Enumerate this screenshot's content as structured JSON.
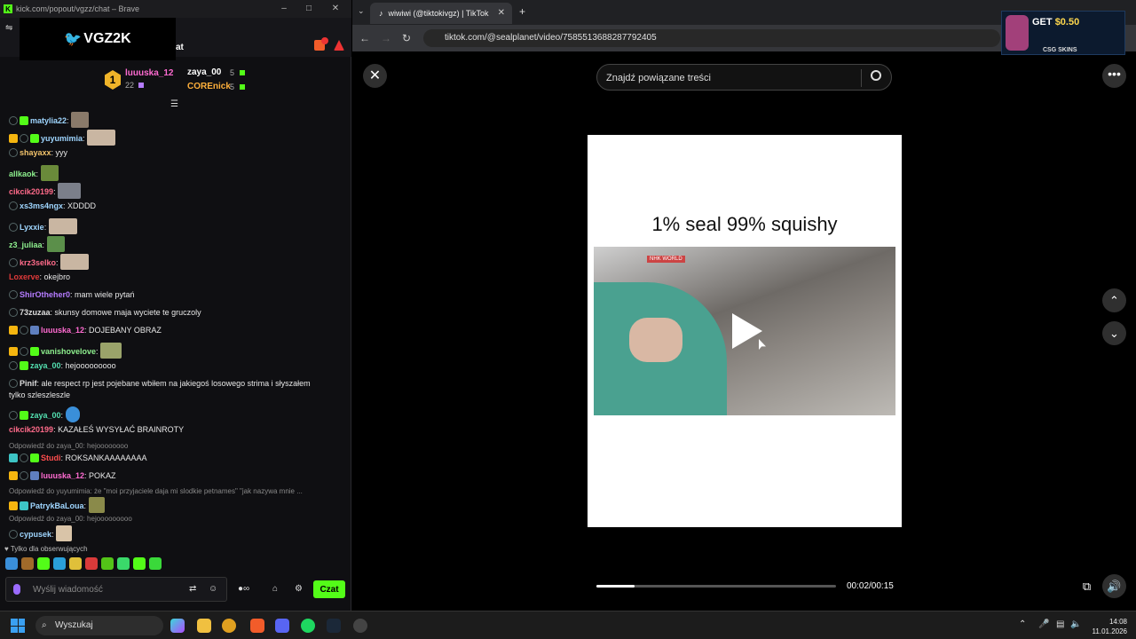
{
  "left_window": {
    "title": "kick.com/popout/vgzz/chat – Brave",
    "banner": "VGZ2K",
    "chat_title": "at"
  },
  "leaderboard": {
    "rank": "1",
    "first": {
      "name": "luuuska_12",
      "count": "22"
    },
    "second": {
      "name": "zaya_00",
      "count": "5"
    },
    "third": {
      "name": "COREnick",
      "count": "5"
    }
  },
  "chat": [
    {
      "user": "matylia22",
      "text": "",
      "color": "#9fd6ff"
    },
    {
      "user": "yuyumimia",
      "text": "",
      "color": "#9fd6ff"
    },
    {
      "user": "shayaxx",
      "text": " yyy",
      "color": "#f2c36b"
    },
    {
      "user": "allkaok",
      "text": "",
      "color": "#8ef08e"
    },
    {
      "user": "cikcik20199",
      "text": "",
      "color": "#ff6b8a"
    },
    {
      "user": "xs3ms4ngx",
      "text": " XDDDD",
      "color": "#9fd6ff"
    },
    {
      "user": "Lyxxie",
      "text": "",
      "color": "#9fd6ff"
    },
    {
      "user": "z3_juliaa",
      "text": "",
      "color": "#8ef08e"
    },
    {
      "user": "krz3selko",
      "text": "",
      "color": "#ff6b8a"
    },
    {
      "user": "Loxerve",
      "text": " okejbro",
      "color": "#e03a3a"
    },
    {
      "user": "ShirOtheher0",
      "text": " mam wiele pytań",
      "color": "#b57cff"
    },
    {
      "user": "73zuzaa",
      "text": " skunsy domowe maja wyciete te gruczoly",
      "color": "#dddddd"
    },
    {
      "user": "luuuska_12",
      "text": " DOJEBANY OBRAZ",
      "color": "#ff6bd1"
    },
    {
      "user": "vanishovelove",
      "text": "",
      "color": "#8ef08e"
    },
    {
      "user": "zaya_00",
      "text": " hejooooooooo",
      "color": "#53e0b0"
    },
    {
      "user": "Pinif",
      "text": " ale respect rp jest pojebane wbiłem na jakiegoś losowego strima i słyszałem",
      "color": "#dddddd"
    },
    {
      "user": "",
      "text": "tylko szleszleszle",
      "color": "#dddddd"
    },
    {
      "user": "zaya_00",
      "text": "",
      "color": "#53e0b0"
    },
    {
      "user": "cikcik20199",
      "text": " KAZAŁEŚ WYSYŁAĆ BRAINROTY",
      "color": "#ff6b8a"
    },
    {
      "user": "Studi",
      "text": " ROKSANKAAAAAAAA",
      "color": "#ff4d4d"
    },
    {
      "user": "luuuska_12",
      "text": " POKAZ",
      "color": "#ff6bd1"
    },
    {
      "user": "PatrykBaLoua",
      "text": "",
      "color": "#9fd6ff"
    },
    {
      "user": "cypusek",
      "text": "",
      "color": "#9fd6ff"
    }
  ],
  "replies": [
    "Odpowiedź do zaya_00: hejoooooooo",
    "Odpowiedź do yuyumimia: że \"moi przyjaciele daja mi slodkie petnames\" \"jak nazywa mnie ...",
    "Odpowiedź do zaya_00: hejooooooooo"
  ],
  "follow_note": "Tylko dla obserwujących",
  "input": {
    "placeholder": "Wyślij wiadomość",
    "send_label": "Czat"
  },
  "browser": {
    "tab_title": "wiwiwi (@tiktokivgz) | TikTok",
    "url": "tiktok.com/@sealplanet/video/7585513688287792405"
  },
  "ad": {
    "get": "GET",
    "amount": "$0.50",
    "brand": "CSG SKINS"
  },
  "tiktok": {
    "search_placeholder": "Znajdź powiązane treści",
    "caption": "1% seal 99% squishy",
    "time": "00:02/00:15",
    "progress": 0.16,
    "watermark": "NHK WORLD"
  },
  "taskbar": {
    "search": "Wyszukaj",
    "time": "14:08",
    "date": "11.01.2026"
  },
  "colors": {
    "kick_green": "#53fc18",
    "tiktok_bg": "#000000"
  }
}
